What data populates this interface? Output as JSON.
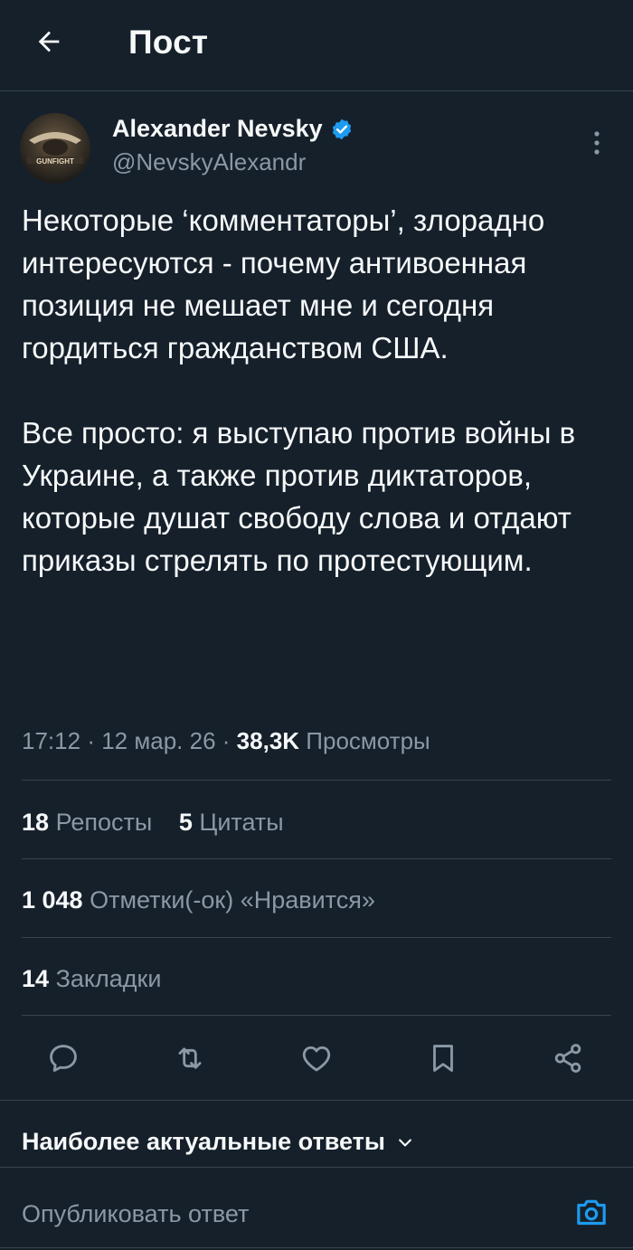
{
  "header": {
    "title": "Пост",
    "back_icon": "arrow-left-icon"
  },
  "author": {
    "name": "Alexander Nevsky",
    "handle": "@NevskyAlexandr",
    "verified": true,
    "verified_color": "#1d9bf0",
    "avatar_text": "GUNFIGHT"
  },
  "tweet": {
    "paragraphs": [
      "Некоторые ‘комментаторы’, злорадно интересуются - почему антивоенная позиция не мешает мне и сегодня гордиться гражданством США.",
      "Все просто: я выступаю против войны в Украине, а также против диктаторов, которые душат свободу слова и отдают приказы стрелять по протестующим."
    ]
  },
  "meta": {
    "time": "17:12",
    "date": "12 мар. 26",
    "separator": "·",
    "views_count": "38,3K",
    "views_label": "Просмотры"
  },
  "stats": {
    "reposts_count": "18",
    "reposts_label": "Репосты",
    "quotes_count": "5",
    "quotes_label": "Цитаты",
    "likes_count": "1 048",
    "likes_label": "Отметки(-ок) «Нравится»",
    "bookmarks_count": "14",
    "bookmarks_label": "Закладки"
  },
  "actions": [
    "reply-icon",
    "repost-icon",
    "like-icon",
    "bookmark-icon",
    "share-icon"
  ],
  "replies": {
    "sort_label": "Наиболее актуальные ответы",
    "reply_placeholder": "Опубликовать ответ"
  },
  "colors": {
    "background": "#15202b",
    "text_primary": "#f7f9f9",
    "text_secondary": "#8b98a5",
    "divider": "#38444d",
    "accent": "#1d9bf0"
  }
}
